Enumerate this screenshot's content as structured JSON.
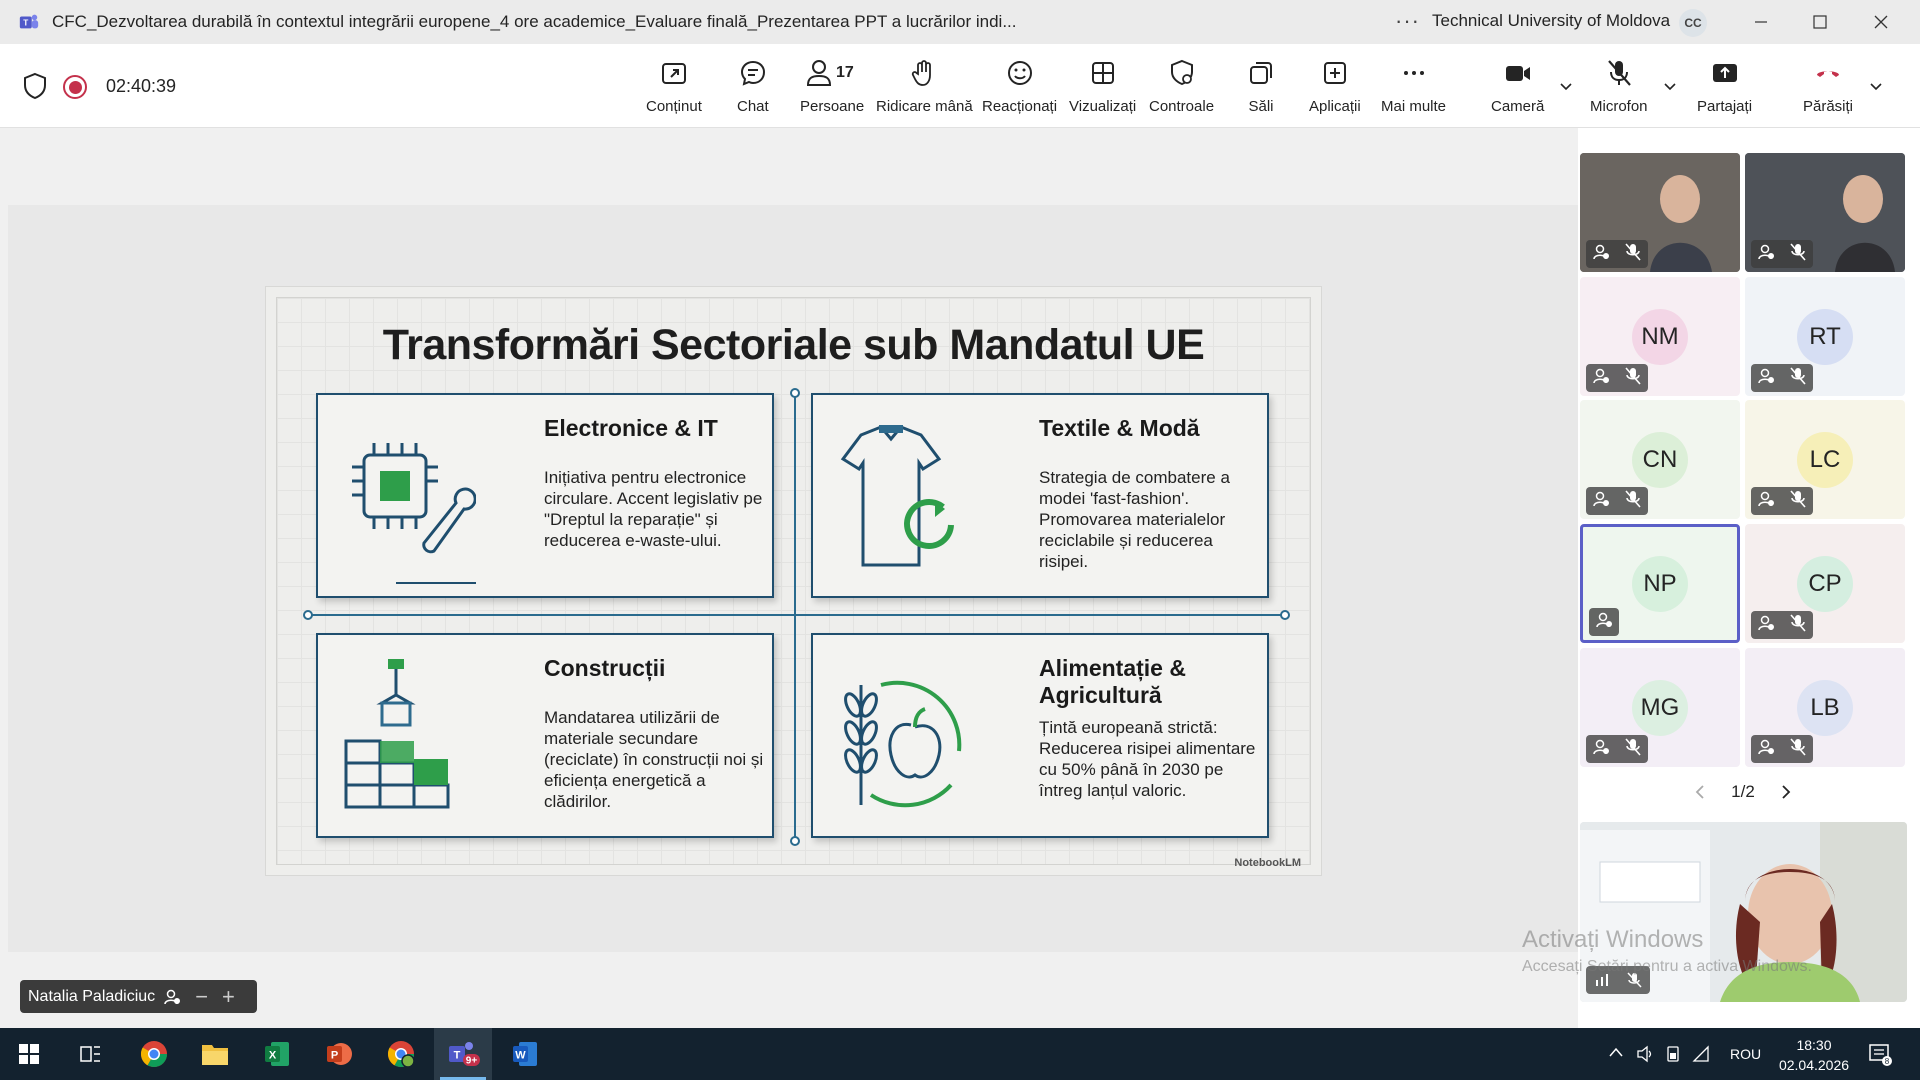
{
  "window": {
    "title": "CFC_Dezvoltarea durabilă în contextul integrării europene_4 ore academice_Evaluare finală_Prezentarea PPT a lucrărilor indi...",
    "organization": "Technical University of Moldova",
    "org_initials": "CC"
  },
  "meeting": {
    "timer": "02:40:39",
    "people_count": "17",
    "toolbar": [
      {
        "label": "Conținut",
        "icon": "share-content-icon"
      },
      {
        "label": "Chat",
        "icon": "chat-icon"
      },
      {
        "label": "Persoane",
        "icon": "people-icon"
      },
      {
        "label": "Ridicare mână",
        "icon": "raise-hand-icon"
      },
      {
        "label": "Reacționați",
        "icon": "reactions-icon"
      },
      {
        "label": "Vizualizați",
        "icon": "view-icon"
      },
      {
        "label": "Controale",
        "icon": "controls-icon"
      },
      {
        "label": "Săli",
        "icon": "rooms-icon"
      },
      {
        "label": "Aplicații",
        "icon": "apps-icon"
      },
      {
        "label": "Mai multe",
        "icon": "more-icon"
      },
      {
        "label": "Cameră",
        "icon": "camera-icon"
      },
      {
        "label": "Microfon",
        "icon": "mic-off-icon"
      },
      {
        "label": "Partajați",
        "icon": "share-icon"
      },
      {
        "label": "Părăsiți",
        "icon": "leave-icon"
      }
    ]
  },
  "slide": {
    "title": "Transformări Sectoriale sub Mandatul UE",
    "cards": [
      {
        "heading": "Electronice & IT",
        "body": "Inițiativa pentru electronice circulare. Accent legislativ pe \"Dreptul la reparație\" și reducerea e-waste-ului."
      },
      {
        "heading": "Textile & Modă",
        "body": "Strategia de combatere a modei 'fast-fashion'. Promovarea materialelor reciclabile și reducerea risipei."
      },
      {
        "heading": "Construcții",
        "body": "Mandatarea utilizării de materiale secundare (reciclate) în construcții noi și eficiența energetică a clădirilor."
      },
      {
        "heading": "Alimentație & Agricultură",
        "body": "Țintă europeană strictă: Reducerea risipei alimentare cu 50% până în 2030 pe întreg lanțul valoric."
      }
    ],
    "watermark": "NotebookLM"
  },
  "participants": [
    {
      "initials": "",
      "video": true,
      "bg": "#6a6560"
    },
    {
      "initials": "",
      "video": true,
      "bg": "#4e5258"
    },
    {
      "initials": "NM",
      "avatar_color": "#f3d6e6",
      "tile_bg": "#f7eef3"
    },
    {
      "initials": "RT",
      "avatar_color": "#d6def3",
      "tile_bg": "#f0f3f7"
    },
    {
      "initials": "CN",
      "avatar_color": "#dcefd8",
      "tile_bg": "#f2f6ef"
    },
    {
      "initials": "LC",
      "avatar_color": "#f6efb8",
      "tile_bg": "#f7f5e8"
    },
    {
      "initials": "NP",
      "avatar_color": "#d7f0dd",
      "tile_bg": "#eef6ee",
      "active": true
    },
    {
      "initials": "CP",
      "avatar_color": "#d5eee0",
      "tile_bg": "#f5eeee"
    },
    {
      "initials": "MG",
      "avatar_color": "#dcefe1",
      "tile_bg": "#f3eef6"
    },
    {
      "initials": "LB",
      "avatar_color": "#dde3f3",
      "tile_bg": "#f3eef5"
    }
  ],
  "pager": "1/2",
  "presenter_name": "Natalia Paladiciuc",
  "windows_watermark": {
    "line1": "Activați Windows",
    "line2": "Accesați Setări pentru a activa Windows."
  },
  "taskbar": {
    "language": "ROU",
    "time": "18:30",
    "date": "02.04.2026",
    "notifications": "8",
    "teams_badge": "9+"
  },
  "colors": {
    "accent": "#6264a7",
    "leave": "#c4314b",
    "slide_green": "#2e9e4a",
    "slide_navy": "#1f4e6e"
  }
}
